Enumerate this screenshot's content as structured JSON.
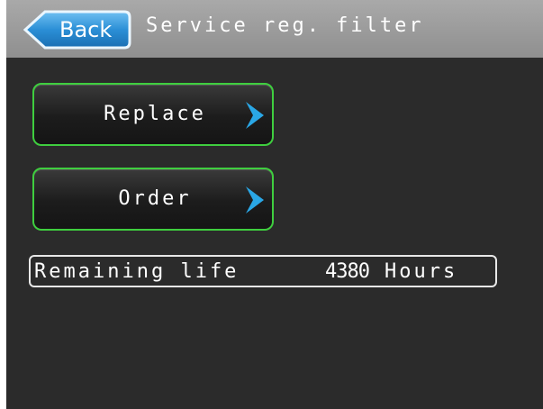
{
  "header": {
    "back_label": "Back",
    "title": "Service reg. filter"
  },
  "menu": {
    "replace_label": "Replace",
    "order_label": "Order"
  },
  "status": {
    "remaining_label": "Remaining life",
    "remaining_value": "4380",
    "remaining_unit": "Hours"
  },
  "icons": {
    "back": "back-arrow-icon",
    "chevron": "chevron-right-icon"
  },
  "colors": {
    "accent_green": "#3fce3f",
    "chevron_blue": "#2aa7e6",
    "back_blue": "#2b8fd6"
  }
}
